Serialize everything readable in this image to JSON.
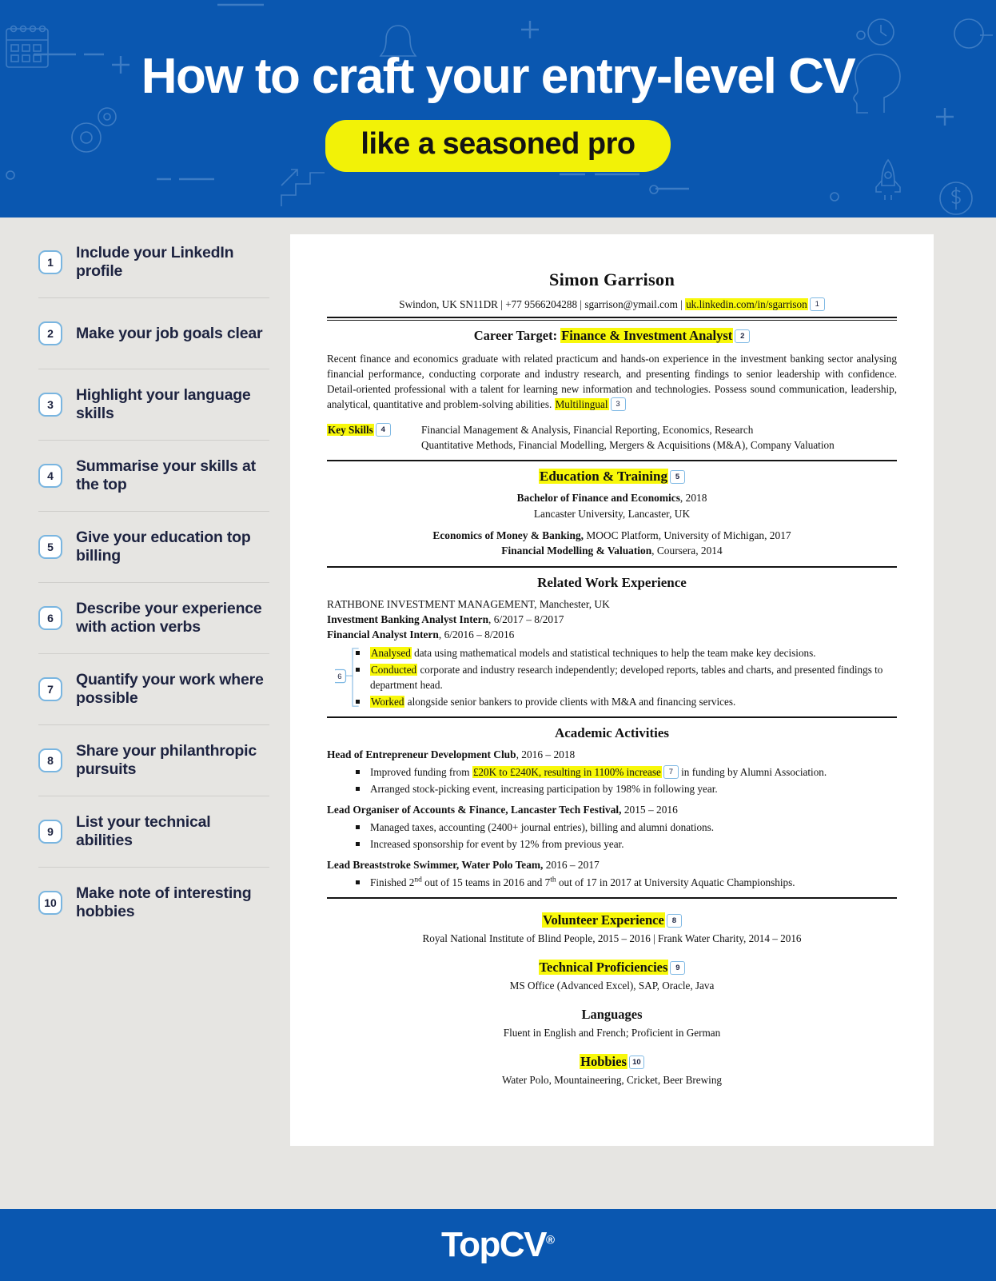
{
  "colors": {
    "brand_blue": "#0a57b0",
    "highlight_yellow": "#f8f80a",
    "hero_yellow": "#f2f207",
    "page_bg": "#e6e5e2",
    "badge_border": "#79b5e0",
    "text_navy": "#1d2340"
  },
  "hero": {
    "title": "How to craft your entry-level CV",
    "subtitle": "like a seasoned pro"
  },
  "sidebar": {
    "items": [
      {
        "num": "1",
        "label": "Include your LinkedIn profile"
      },
      {
        "num": "2",
        "label": "Make your job goals clear"
      },
      {
        "num": "3",
        "label": "Highlight your language skills"
      },
      {
        "num": "4",
        "label": "Summarise your skills at the top"
      },
      {
        "num": "5",
        "label": "Give your education top billing"
      },
      {
        "num": "6",
        "label": "Describe your experience with action verbs"
      },
      {
        "num": "7",
        "label": "Quantify your work where possible"
      },
      {
        "num": "8",
        "label": "Share your philanthropic pursuits"
      },
      {
        "num": "9",
        "label": "List your technical abilities"
      },
      {
        "num": "10",
        "label": "Make note of interesting hobbies"
      }
    ]
  },
  "cv": {
    "name": "Simon Garrison",
    "contact": {
      "address": "Swindon, UK SN11DR",
      "phone": "+77 9566204288",
      "email": "sgarrison@ymail.com",
      "linkedin": "uk.linkedin.com/in/sgarrison",
      "linkedin_badge": "1",
      "separator": " | "
    },
    "career_target": {
      "label": "Career Target: ",
      "value": "Finance & Investment Analyst",
      "badge": "2"
    },
    "summary": {
      "text": "Recent finance and economics graduate with related practicum and hands-on experience in the investment banking sector analysing financial performance, conducting corporate and industry research, and presenting findings to senior leadership with confidence. Detail-oriented professional with a talent for learning new information and technologies. Possess sound communication, leadership, analytical, quantitative and problem-solving abilities. ",
      "highlight_word": "Multilingual",
      "badge": "3"
    },
    "key_skills": {
      "label": "Key Skills",
      "badge": "4",
      "line1": "Financial Management & Analysis, Financial Reporting, Economics, Research",
      "line2": "Quantitative Methods, Financial Modelling, Mergers & Acquisitions (M&A), Company Valuation"
    },
    "education": {
      "heading": "Education & Training",
      "badge": "5",
      "degree": "Bachelor of Finance and Economics",
      "degree_year": ", 2018",
      "school": "Lancaster University, Lancaster, UK",
      "course1_bold": "Economics of Money & Banking,",
      "course1_rest": " MOOC Platform, University of Michigan, 2017",
      "course2_bold": "Financial Modelling & Valuation",
      "course2_rest": ", Coursera, 2014"
    },
    "work": {
      "heading": "Related Work Experience",
      "org": "RATHBONE INVESTMENT MANAGEMENT, Manchester, UK",
      "role1_bold": "Investment Banking Analyst Intern",
      "role1_rest": ", 6/2017 – 8/2017",
      "role2_bold": "Financial Analyst Intern",
      "role2_rest": ", 6/2016 – 8/2016",
      "callout_badge": "6",
      "bullets": [
        {
          "verb": "Analysed",
          "rest": " data using mathematical models and statistical techniques to help the team make key decisions."
        },
        {
          "verb": "Conducted",
          "rest": " corporate and industry research independently; developed reports, tables and charts, and presented findings to department head."
        },
        {
          "verb": "Worked",
          "rest": " alongside senior bankers to provide clients with M&A and financing services."
        }
      ]
    },
    "academic": {
      "heading": "Academic Activities",
      "entries": [
        {
          "title_bold": "Head of Entrepreneur Development Club",
          "title_rest": ", 2016 – 2018",
          "bullets": [
            {
              "pre": "Improved funding from ",
              "highlight": "£20K to £240K, resulting in 1100% increase",
              "badge": "7",
              "post": " in funding by Alumni Association."
            },
            {
              "pre": "Arranged stock-picking event, increasing participation by 198% in following year."
            }
          ]
        },
        {
          "title_bold": "Lead Organiser of Accounts & Finance, Lancaster Tech Festival,",
          "title_rest": " 2015 – 2016",
          "bullets": [
            {
              "pre": "Managed taxes, accounting (2400+ journal entries), billing and alumni donations."
            },
            {
              "pre": "Increased sponsorship for event by 12% from previous year."
            }
          ]
        },
        {
          "title_bold": "Lead Breaststroke Swimmer, Water Polo Team,",
          "title_rest": " 2016 – 2017",
          "bullets": [
            {
              "pre": "Finished 2nd out of 15 teams in 2016 and 7th out of 17 in 2017 at University Aquatic Championships."
            }
          ]
        }
      ]
    },
    "volunteer": {
      "heading": "Volunteer Experience",
      "badge": "8",
      "text": "Royal National Institute of Blind People, 2015 – 2016 | Frank Water Charity, 2014 – 2016"
    },
    "technical": {
      "heading": "Technical Proficiencies",
      "badge": "9",
      "text": "MS Office (Advanced Excel), SAP, Oracle, Java"
    },
    "languages": {
      "heading": "Languages",
      "text": "Fluent in English and French; Proficient in German"
    },
    "hobbies": {
      "heading": "Hobbies",
      "badge": "10",
      "text": "Water Polo, Mountaineering, Cricket, Beer Brewing"
    }
  },
  "footer": {
    "brand": "TopCV",
    "registered": "®"
  }
}
